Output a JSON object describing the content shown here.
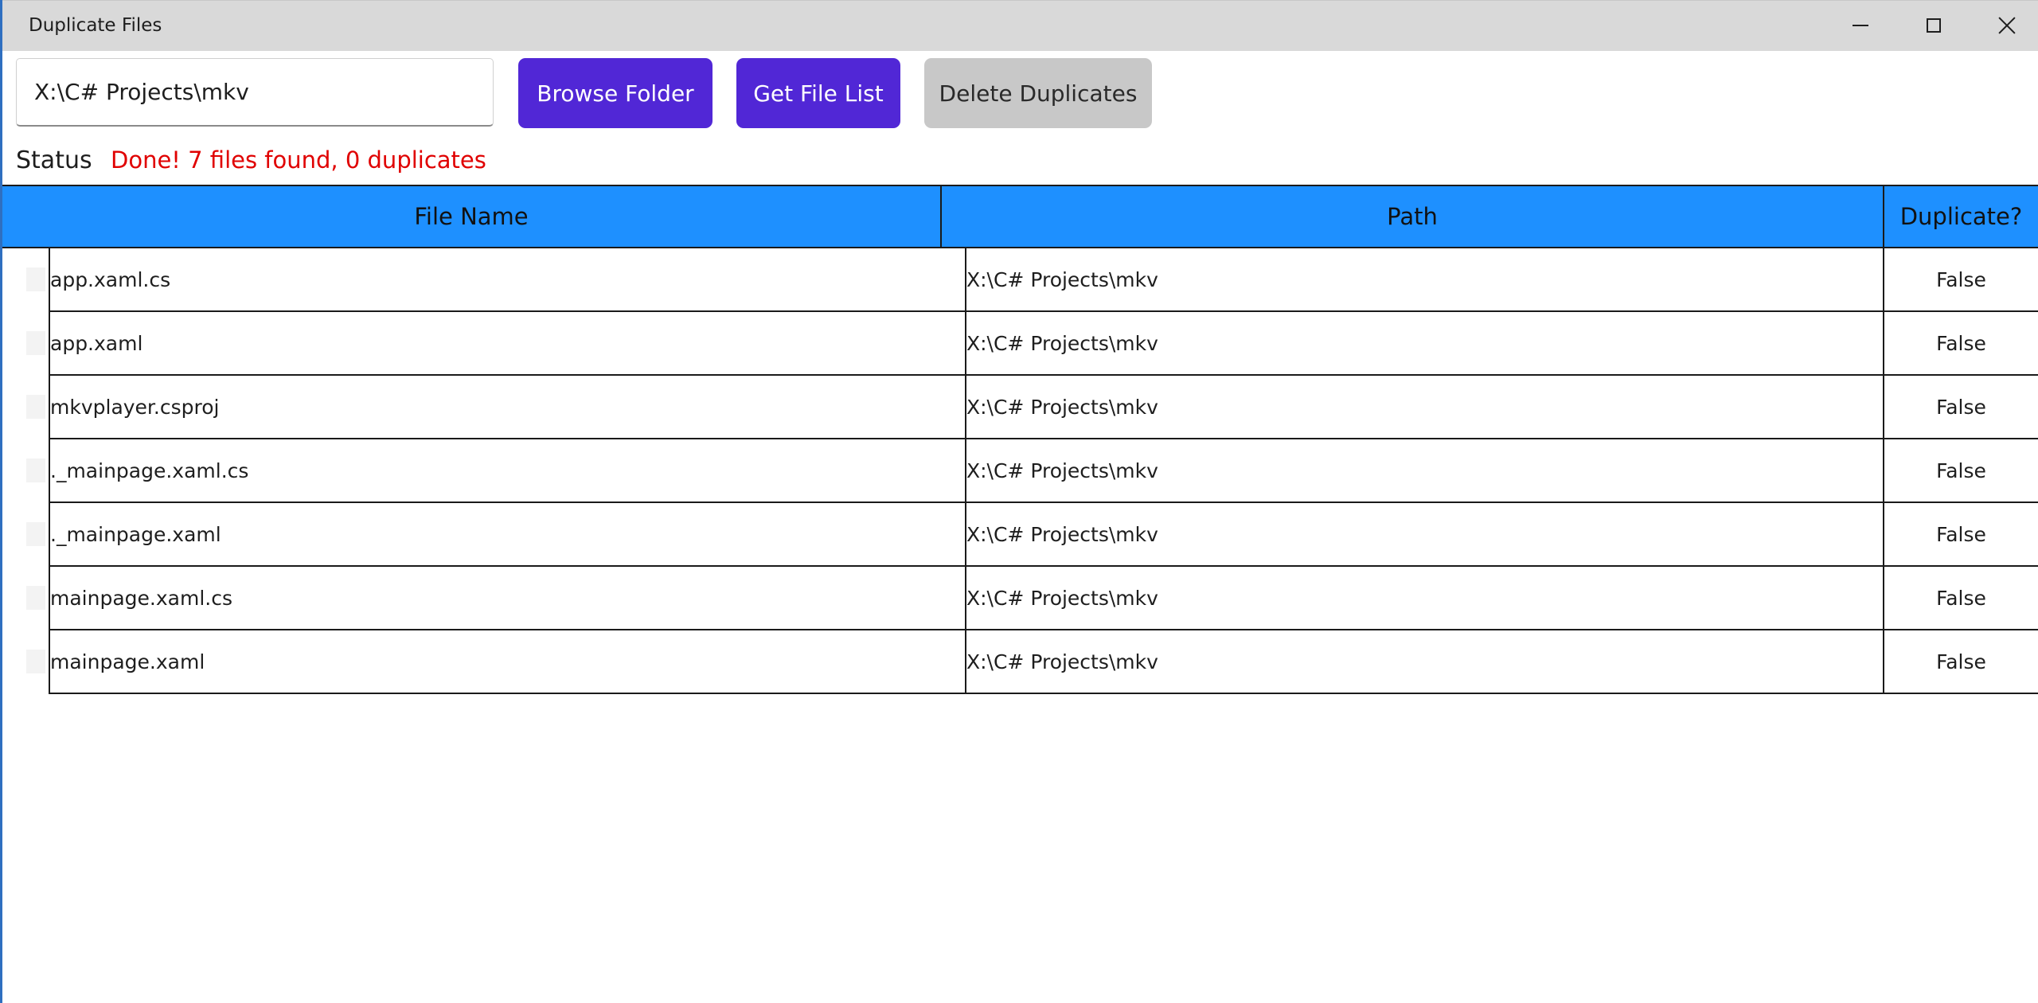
{
  "window": {
    "title": "Duplicate Files"
  },
  "toolbar": {
    "path_value": "X:\\C# Projects\\mkv",
    "browse_label": "Browse Folder",
    "get_list_label": "Get File List",
    "delete_label": "Delete Duplicates"
  },
  "status": {
    "label": "Status",
    "message": "Done! 7 files found, 0 duplicates",
    "message_color": "#e00000"
  },
  "grid": {
    "header_color": "#1e90ff",
    "columns": [
      "File Name",
      "Path",
      "Duplicate?"
    ],
    "rows": [
      {
        "name": "app.xaml.cs",
        "path": "X:\\C# Projects\\mkv",
        "duplicate": "False"
      },
      {
        "name": "app.xaml",
        "path": "X:\\C# Projects\\mkv",
        "duplicate": "False"
      },
      {
        "name": "mkvplayer.csproj",
        "path": "X:\\C# Projects\\mkv",
        "duplicate": "False"
      },
      {
        "name": "._mainpage.xaml.cs",
        "path": "X:\\C# Projects\\mkv",
        "duplicate": "False"
      },
      {
        "name": "._mainpage.xaml",
        "path": "X:\\C# Projects\\mkv",
        "duplicate": "False"
      },
      {
        "name": "mainpage.xaml.cs",
        "path": "X:\\C# Projects\\mkv",
        "duplicate": "False"
      },
      {
        "name": "mainpage.xaml",
        "path": "X:\\C# Projects\\mkv",
        "duplicate": "False"
      }
    ]
  },
  "colors": {
    "accent_button": "#5127d6",
    "disabled_button": "#c8c8c8",
    "titlebar": "#d9d9d9"
  }
}
